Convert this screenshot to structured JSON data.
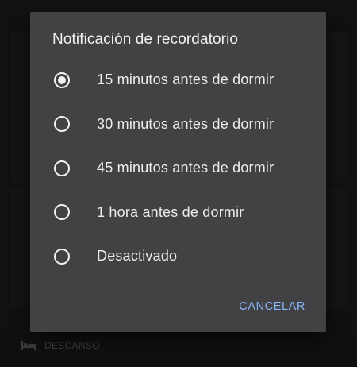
{
  "dialog": {
    "title": "Notificación de recordatorio",
    "options": [
      {
        "label": "15 minutos antes de dormir",
        "selected": true
      },
      {
        "label": "30 minutos antes de dormir",
        "selected": false
      },
      {
        "label": "45 minutos antes de dormir",
        "selected": false
      },
      {
        "label": "1 hora antes de dormir",
        "selected": false
      },
      {
        "label": "Desactivado",
        "selected": false
      }
    ],
    "cancel_label": "CANCELAR"
  },
  "background": {
    "bottom_nav_label": "DESCANSO",
    "bottom_nav_icon": "bed-icon"
  },
  "colors": {
    "accent": "#8ab4f8",
    "dialog_surface": "#424244",
    "scrim": "#111112"
  }
}
